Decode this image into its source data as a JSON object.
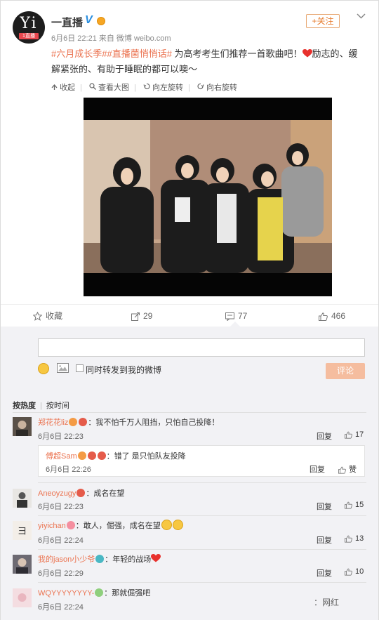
{
  "post": {
    "username": "一直播",
    "verified_badge": "V",
    "follow_label": "+关注",
    "avatar_text": "Yi",
    "avatar_tag": "1直播",
    "meta": "6月6日 22:21 来自 微博 weibo.com",
    "topics": "#六月成长季##直播菌悄悄话#",
    "text_line1": " 为高考考生们推荐一首歌曲吧！",
    "text_line1b": "励志的、缓",
    "text_line2": "解紧张的、有助于睡眠的都可以噢～",
    "heart_icon": "red-heart-icon"
  },
  "media_tools": [
    {
      "label": "收起",
      "icon": "collapse-icon"
    },
    {
      "label": "查看大图",
      "icon": "magnifier-icon"
    },
    {
      "label": "向左旋转",
      "icon": "rotate-left-icon"
    },
    {
      "label": "向右旋转",
      "icon": "rotate-right-icon"
    }
  ],
  "actions": {
    "favorite": "收藏",
    "repost": "29",
    "comment": "77",
    "like": "466"
  },
  "comment_box": {
    "placeholder": "",
    "repost_checkbox_label": "同时转发到我的微博",
    "submit_label": "评论"
  },
  "sort_tabs": {
    "hot": "按热度",
    "time": "按时间"
  },
  "comments": [
    {
      "name": "郑花花liz",
      "text": "：我不怕千万人阻挡，只怕自己投降！",
      "time": "6月6日 22:23",
      "reply": "回复",
      "likes": "17"
    },
    {
      "name": "Aneoyzugy",
      "text": "：成名在望",
      "time": "6月6日 22:23",
      "reply": "回复",
      "likes": "15"
    },
    {
      "name": "yiyichan",
      "text": "：敢人，倔强，成名在望",
      "time": "6月6日 22:24",
      "reply": "回复",
      "likes": "13"
    },
    {
      "name": "我的jason小少爷",
      "text": "：年轻的战场",
      "time": "6月6日 22:29",
      "reply": "回复",
      "likes": "10"
    },
    {
      "name": "WQYYYYYYYY-",
      "text": "：那就倔强吧",
      "time": "6月6日 22:24"
    }
  ],
  "sub_reply": {
    "name": "傅超Sam",
    "text": "：错了 是只怕队友投降",
    "time": "6月6日 22:26",
    "reply": "回复",
    "like": "赞"
  },
  "watermark": "：网红",
  "colors": {
    "accent": "#eb7350",
    "link_blue": "#2b8fe0",
    "comment_bg": "#f2f2f5"
  }
}
